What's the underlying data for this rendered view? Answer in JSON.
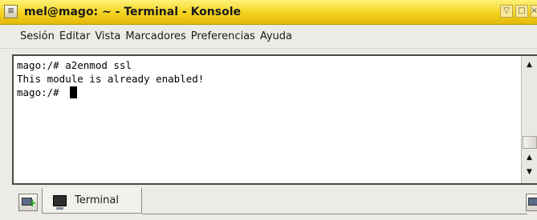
{
  "window": {
    "title": "mel@mago: ~ - Terminal - Konsole",
    "menu_icon": "konsole-window-menu-icon",
    "menu_icon_glyph": "⊠",
    "buttons": {
      "minimize_glyph": "▽",
      "maximize_glyph": "□",
      "close_glyph": "×"
    }
  },
  "menubar": {
    "items": [
      "Sesión",
      "Editar",
      "Vista",
      "Marcadores",
      "Preferencias",
      "Ayuda"
    ]
  },
  "terminal": {
    "lines": [
      "mago:/# a2enmod ssl",
      "This module is already enabled!",
      "mago:/# "
    ],
    "background": "#ffffff",
    "foreground": "#000000"
  },
  "scrollbar": {
    "up_glyph": "▲",
    "down_glyph": "▼"
  },
  "tabs": {
    "items": [
      {
        "label": "Terminal",
        "icon": "terminal-icon"
      }
    ],
    "new_tab_icon": "new-session-icon",
    "close_tab_icon": "close-session-icon"
  },
  "colors": {
    "titlebar_accent": "#f3d21e",
    "chrome": "#ecebe6"
  }
}
